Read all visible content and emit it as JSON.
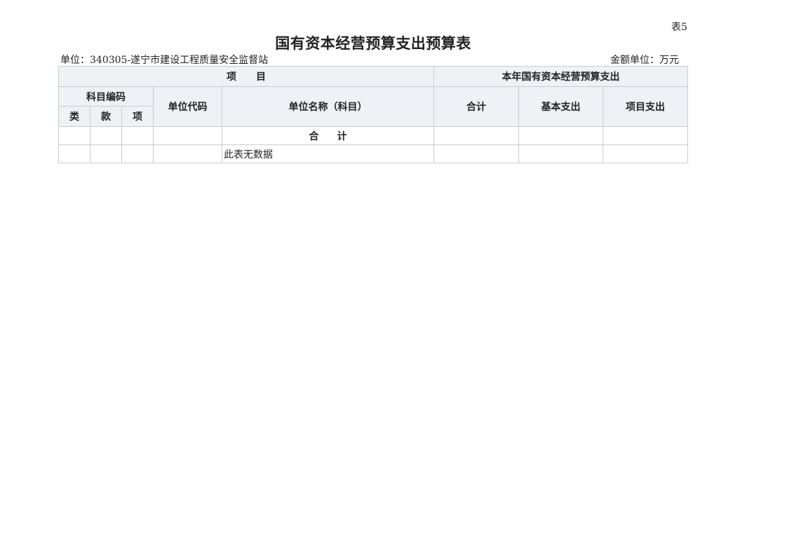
{
  "table_no": "表5",
  "title": "国有资本经营预算支出预算表",
  "unit_label": "单位：340305-遂宁市建设工程质量安全监督站",
  "amount_unit": "金额单位：万元",
  "header": {
    "project": "项目",
    "current_year_expense": "本年国有资本经营预算支出",
    "subject_code": "科目编码",
    "category": "类",
    "section": "款",
    "item": "项",
    "unit_code": "单位代码",
    "unit_name": "单位名称（科目）",
    "total": "合计",
    "basic_expense": "基本支出",
    "project_expense": "项目支出"
  },
  "rows": {
    "total_label": "合计",
    "no_data": "此表无数据"
  }
}
